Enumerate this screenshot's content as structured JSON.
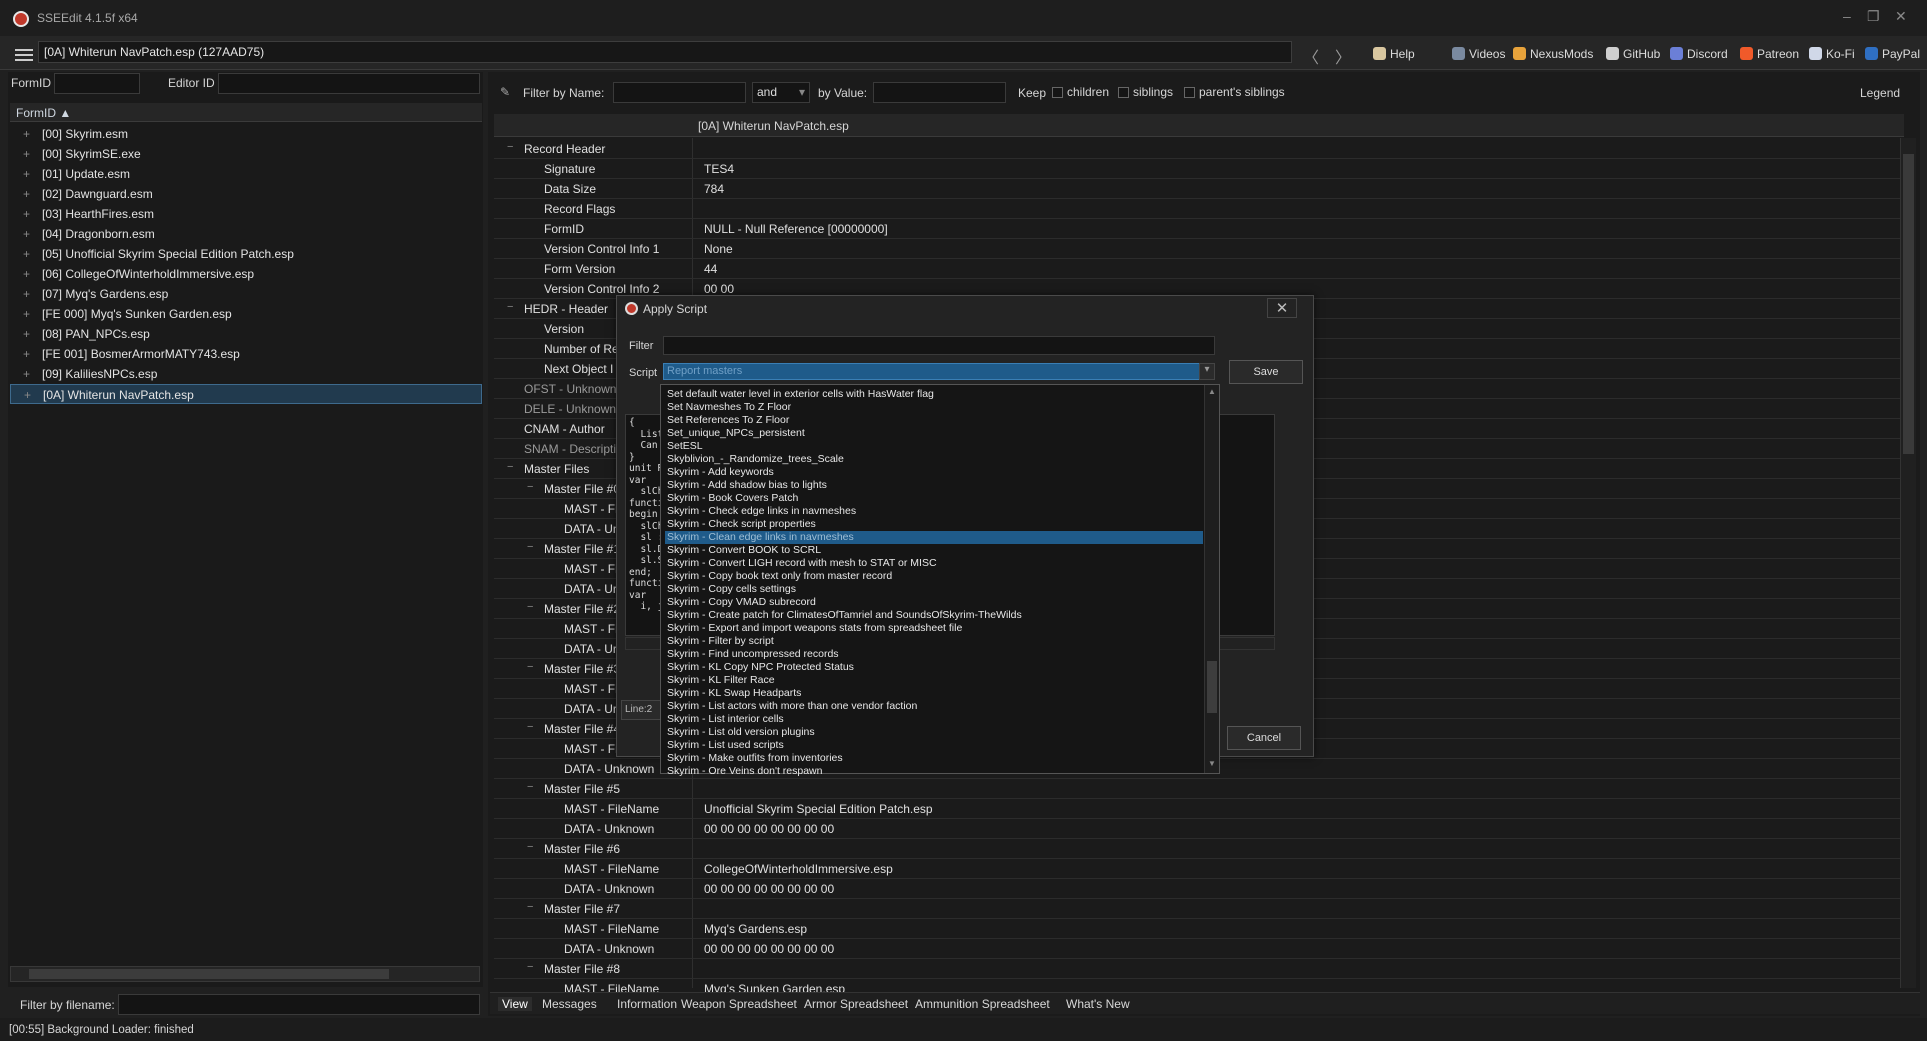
{
  "window": {
    "title": "SSEEdit 4.1.5f x64",
    "controls": [
      "–",
      "❐",
      "✕"
    ]
  },
  "toolbar": {
    "path": "[0A] Whiterun NavPatch.esp (127AAD75)",
    "back": "〈",
    "forward": "〉",
    "links": [
      {
        "label": "Help",
        "icon": "book-icon",
        "color": "#d9c7a0"
      },
      {
        "label": "Videos",
        "icon": "gp-icon",
        "color": "#7a8aa0"
      },
      {
        "label": "NexusMods",
        "icon": "nexus-icon",
        "color": "#e8a33b"
      },
      {
        "label": "GitHub",
        "icon": "github-icon",
        "color": "#cfcfcf"
      },
      {
        "label": "Discord",
        "icon": "discord-icon",
        "color": "#6b7fd7"
      },
      {
        "label": "Patreon",
        "icon": "patreon-icon",
        "color": "#f05a2a"
      },
      {
        "label": "Ko-Fi",
        "icon": "kofi-icon",
        "color": "#d0d8e8"
      },
      {
        "label": "PayPal",
        "icon": "paypal-icon",
        "color": "#2f6fc2"
      }
    ]
  },
  "left": {
    "formid_label": "FormID",
    "editorid_label": "Editor ID",
    "tree_header": "FormID ▲",
    "files": [
      "[00] Skyrim.esm",
      "[00] SkyrimSE.exe",
      "[01] Update.esm",
      "[02] Dawnguard.esm",
      "[03] HearthFires.esm",
      "[04] Dragonborn.esm",
      "[05] Unofficial Skyrim Special Edition Patch.esp",
      "[06] CollegeOfWinterholdImmersive.esp",
      "[07] Myq's Gardens.esp",
      "[FE 000] Myq's Sunken Garden.esp",
      "[08] PAN_NPCs.esp",
      "[FE 001] BosmerArmorMATY743.esp",
      "[09] KaliliesNPCs.esp",
      "[0A] Whiterun NavPatch.esp"
    ],
    "filter_label": "Filter by filename:"
  },
  "filterbar": {
    "name_label": "Filter by Name:",
    "and_value": "and",
    "value_label": "by Value:",
    "keep": "Keep",
    "children": "children",
    "siblings": "siblings",
    "parents": "parent's siblings",
    "legend": "Legend"
  },
  "record": {
    "header": "[0A] Whiterun NavPatch.esp",
    "rows": [
      {
        "label": "Record Header",
        "value": "",
        "level": 0,
        "exp": "−"
      },
      {
        "label": "Signature",
        "value": "TES4",
        "level": 1
      },
      {
        "label": "Data Size",
        "value": "784",
        "level": 1
      },
      {
        "label": "Record Flags",
        "value": "",
        "level": 1
      },
      {
        "label": "FormID",
        "value": "NULL - Null Reference [00000000]",
        "level": 1
      },
      {
        "label": "Version Control Info 1",
        "value": "None",
        "level": 1
      },
      {
        "label": "Form Version",
        "value": "44",
        "level": 1
      },
      {
        "label": "Version Control Info 2",
        "value": "00 00",
        "level": 1
      },
      {
        "label": "HEDR - Header",
        "value": "",
        "level": 0,
        "exp": "−"
      },
      {
        "label": "Version",
        "value": "",
        "level": 1
      },
      {
        "label": "Number of Re",
        "value": "",
        "level": 1
      },
      {
        "label": "Next Object I",
        "value": "",
        "level": 1
      },
      {
        "label": "OFST - Unknown",
        "value": "",
        "level": 0,
        "dim": true
      },
      {
        "label": "DELE - Unknown",
        "value": "",
        "level": 0,
        "dim": true
      },
      {
        "label": "CNAM - Author",
        "value": "",
        "level": 0
      },
      {
        "label": "SNAM - Descripti",
        "value": "",
        "level": 0,
        "dim": true
      },
      {
        "label": "Master Files",
        "value": "",
        "level": 0,
        "exp": "−"
      },
      {
        "label": "Master File #0",
        "value": "",
        "level": 1,
        "exp": "−"
      },
      {
        "label": "MAST - Fi",
        "value": "",
        "level": 2
      },
      {
        "label": "DATA - Un",
        "value": "",
        "level": 2
      },
      {
        "label": "Master File #1",
        "value": "",
        "level": 1,
        "exp": "−"
      },
      {
        "label": "MAST - Fi",
        "value": "",
        "level": 2
      },
      {
        "label": "DATA - Ur",
        "value": "",
        "level": 2
      },
      {
        "label": "Master File #2",
        "value": "",
        "level": 1,
        "exp": "−"
      },
      {
        "label": "MAST - Fi",
        "value": "",
        "level": 2
      },
      {
        "label": "DATA - Ur",
        "value": "",
        "level": 2
      },
      {
        "label": "Master File #3",
        "value": "",
        "level": 1,
        "exp": "−"
      },
      {
        "label": "MAST - Fi",
        "value": "",
        "level": 2
      },
      {
        "label": "DATA - Ur",
        "value": "",
        "level": 2
      },
      {
        "label": "Master File #4",
        "value": "",
        "level": 1,
        "exp": "−"
      },
      {
        "label": "MAST - Fi",
        "value": "",
        "level": 2
      },
      {
        "label": "DATA - Unknown",
        "value": "",
        "level": 2
      },
      {
        "label": "Master File #5",
        "value": "",
        "level": 1,
        "exp": "−"
      },
      {
        "label": "MAST - FileName",
        "value": "Unofficial Skyrim Special Edition Patch.esp",
        "level": 2
      },
      {
        "label": "DATA - Unknown",
        "value": "00 00 00 00 00 00 00 00",
        "level": 2
      },
      {
        "label": "Master File #6",
        "value": "",
        "level": 1,
        "exp": "−"
      },
      {
        "label": "MAST - FileName",
        "value": "CollegeOfWinterholdImmersive.esp",
        "level": 2
      },
      {
        "label": "DATA - Unknown",
        "value": "00 00 00 00 00 00 00 00",
        "level": 2
      },
      {
        "label": "Master File #7",
        "value": "",
        "level": 1,
        "exp": "−"
      },
      {
        "label": "MAST - FileName",
        "value": "Myq's Gardens.esp",
        "level": 2
      },
      {
        "label": "DATA - Unknown",
        "value": "00 00 00 00 00 00 00 00",
        "level": 2
      },
      {
        "label": "Master File #8",
        "value": "",
        "level": 1,
        "exp": "−"
      },
      {
        "label": "MAST - FileName",
        "value": "Myq's Sunken Garden.esp",
        "level": 2
      }
    ]
  },
  "dialog": {
    "title": "Apply Script",
    "filter_label": "Filter",
    "script_label": "Script",
    "script_value": "Report masters",
    "save": "Save",
    "cancel": "Cancel",
    "line_label": "Line:2",
    "code": [
      "{",
      "  List",
      "  Can",
      "}",
      "unit R",
      "",
      "var",
      "  slCh",
      "",
      "functi",
      "begin",
      "  slCh",
      "  sl :",
      "  sl.D",
      "  sl.S",
      "end;",
      "",
      "functi",
      "var",
      "  i, j"
    ],
    "items": [
      "Set default water level in exterior cells with HasWater flag",
      "Set Navmeshes To Z Floor",
      "Set References To Z Floor",
      "Set_unique_NPCs_persistent",
      "SetESL",
      "Skyblivion_-_Randomize_trees_Scale",
      "Skyrim - Add keywords",
      "Skyrim - Add shadow bias to lights",
      "Skyrim - Book Covers Patch",
      "Skyrim - Check edge links in navmeshes",
      "Skyrim - Check script properties",
      "Skyrim - Clean edge links in navmeshes",
      "Skyrim - Convert BOOK to SCRL",
      "Skyrim - Convert LIGH record with mesh to STAT or MISC",
      "Skyrim - Copy book text only from master record",
      "Skyrim - Copy cells settings",
      "Skyrim - Copy VMAD subrecord",
      "Skyrim - Create patch for ClimatesOfTamriel and SoundsOfSkyrim-TheWilds",
      "Skyrim - Export and import weapons stats from spreadsheet file",
      "Skyrim - Filter by script",
      "Skyrim - Find uncompressed records",
      "Skyrim - KL Copy NPC Protected Status",
      "Skyrim - KL Filter Race",
      "Skyrim - KL Swap Headparts",
      "Skyrim - List actors with more than one vendor faction",
      "Skyrim - List interior cells",
      "Skyrim - List old version plugins",
      "Skyrim - List used scripts",
      "Skyrim - Make outfits from inventories",
      "Skyrim - Ore Veins don't respawn"
    ],
    "selected_index": 11
  },
  "tabs": [
    "View",
    "Messages",
    "Information",
    "Weapon Spreadsheet",
    "Armor Spreadsheet",
    "Ammunition Spreadsheet",
    "What's New"
  ],
  "status": "[00:55] Background Loader: finished"
}
